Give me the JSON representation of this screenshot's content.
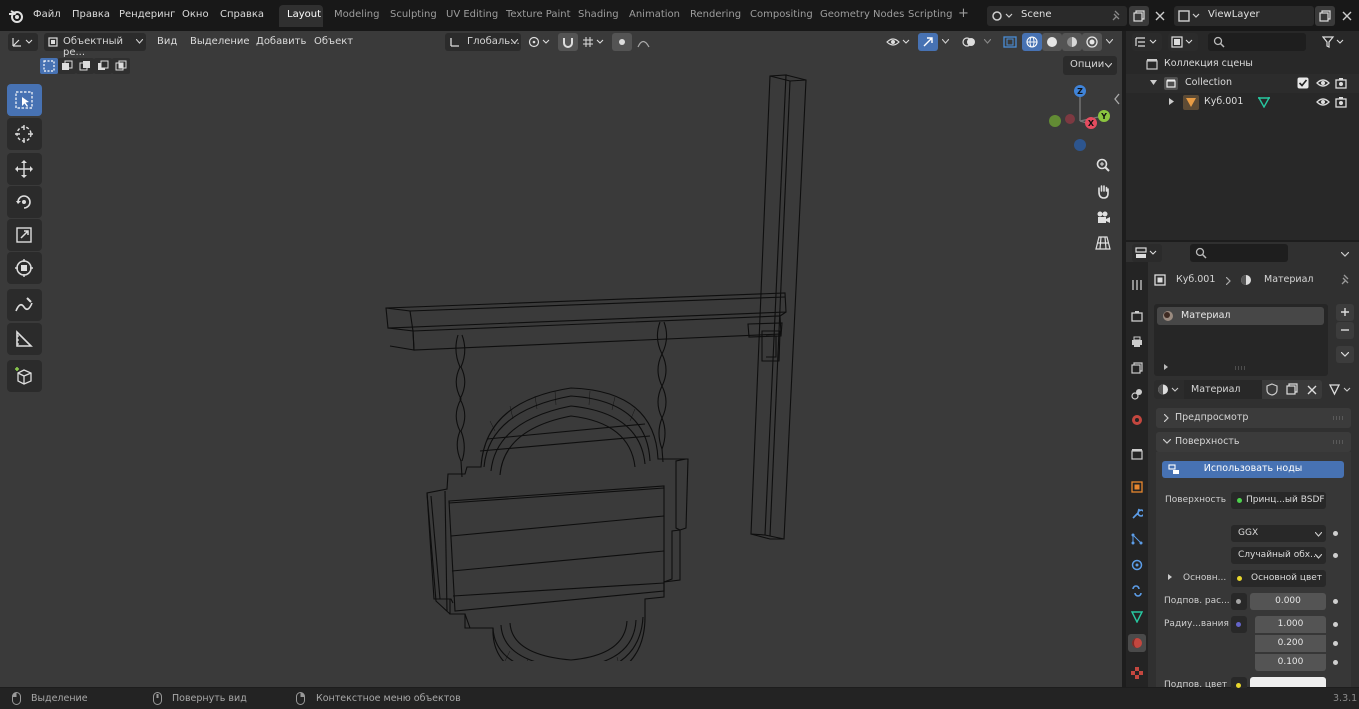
{
  "menu": {
    "items": [
      "Файл",
      "Правка",
      "Рендеринг",
      "Окно",
      "Справка"
    ]
  },
  "workspaces": {
    "tabs": [
      "Layout",
      "Modeling",
      "Sculpting",
      "UV Editing",
      "Texture Paint",
      "Shading",
      "Animation",
      "Rendering",
      "Compositing",
      "Geometry Nodes",
      "Scripting"
    ],
    "active": "Layout",
    "add_label": "+"
  },
  "scene": {
    "name": "Scene",
    "view_layer": "ViewLayer"
  },
  "viewport_header": {
    "mode": "Объектный ре...",
    "menus": [
      "Вид",
      "Выделение",
      "Добавить",
      "Объект"
    ],
    "transform_orientation": "Глобаль...",
    "options_label": "Опции"
  },
  "gizmo": {
    "z": "Z",
    "y": "Y",
    "x": "X"
  },
  "outliner": {
    "search_placeholder": "",
    "scene_collection": "Коллекция сцены",
    "collection": "Collection",
    "object": "Куб.001"
  },
  "properties": {
    "search_placeholder": "",
    "breadcrumb_object": "Куб.001",
    "breadcrumb_material": "Материал",
    "slot_name": "Материал",
    "material_name": "Материал",
    "panels": {
      "preview": "Предпросмотр",
      "surface": "Поверхность"
    },
    "use_nodes": "Использовать ноды",
    "surface_label": "Поверхность",
    "surface_value": "Принц...ый BSDF",
    "distribution": "GGX",
    "subsurface_method": "Случайный обх...",
    "base_color_label": "Основн...",
    "base_color_value": "Основной цвет",
    "subsurface_label": "Подпов. рас...",
    "subsurface_value": "0.000",
    "radius_label": "Радиу...вания",
    "radius_values": [
      "1.000",
      "0.200",
      "0.100"
    ],
    "subsurface_color_label": "Подпов. цвет"
  },
  "statusbar": {
    "select": "Выделение",
    "rotate": "Повернуть вид",
    "context": "Контекстное меню объектов",
    "version": "3.3.1"
  },
  "colors": {
    "accent": "#4772b3",
    "viewport_bg": "#3a3a3a",
    "panel_bg": "#303030",
    "axis_x": "#e44c5f",
    "axis_y": "#8bc43f",
    "axis_z": "#3f83d8"
  }
}
